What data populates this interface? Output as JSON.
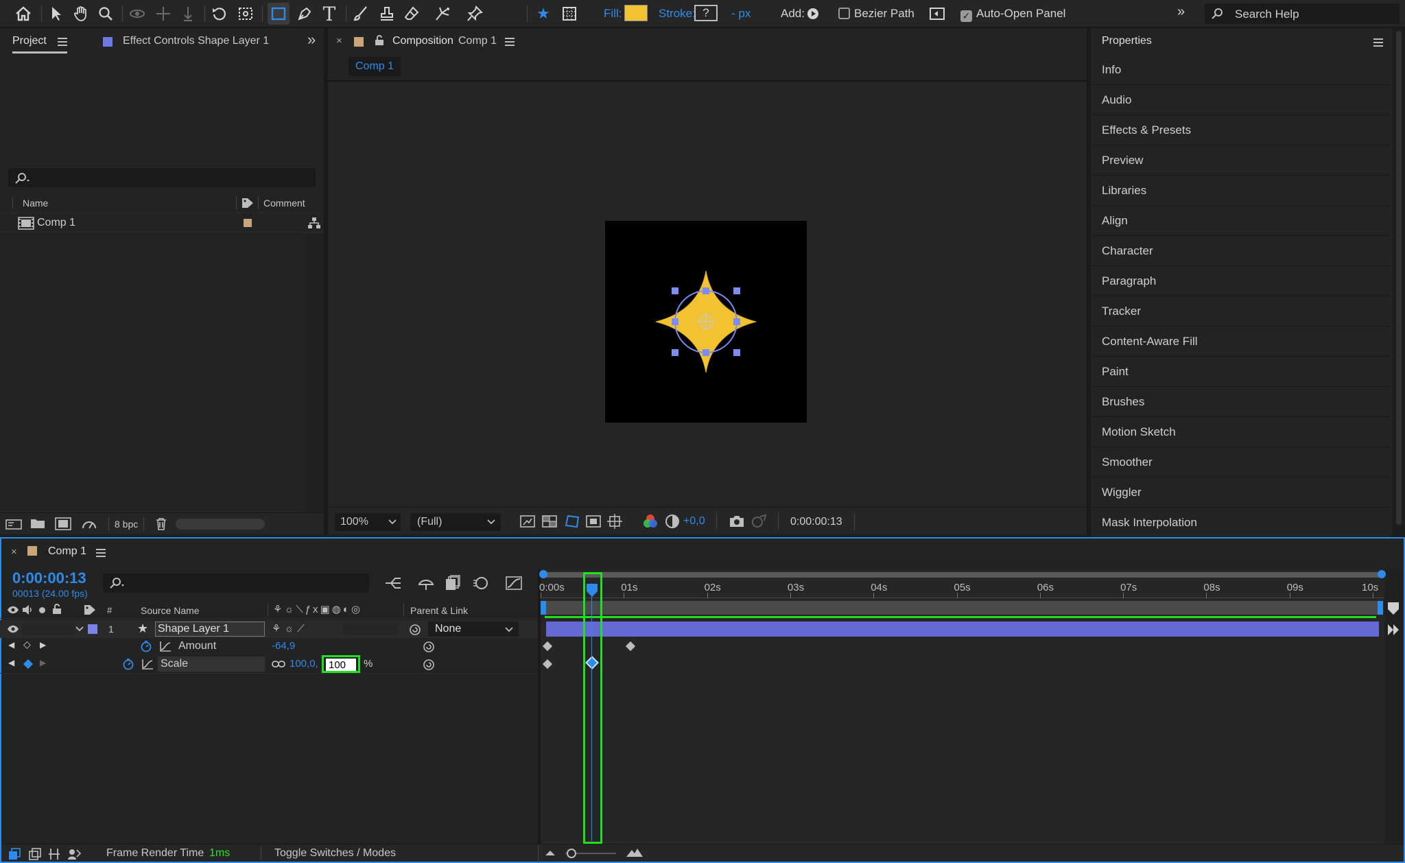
{
  "toolbar": {
    "fill_label": "Fill:",
    "fill_color": "#f2c230",
    "stroke_label": "Stroke:",
    "stroke_value": "?",
    "stroke_unit": "- px",
    "add_label": "Add:",
    "bezier_label": "Bezier Path",
    "auto_open_label": "Auto-Open Panel",
    "search_placeholder": "Search Help"
  },
  "project_panel": {
    "tab_project": "Project",
    "tab_effect_controls": "Effect Controls Shape Layer 1",
    "col_name": "Name",
    "col_comment": "Comment",
    "items": [
      {
        "name": "Comp 1",
        "label_color": "#c8a67a"
      }
    ],
    "bpc": "8 bpc"
  },
  "composition_panel": {
    "tab_prefix": "Composition",
    "tab_name": "Comp 1",
    "subtab": "Comp 1",
    "zoom": "100%",
    "resolution": "(Full)",
    "exposure": "+0,0",
    "timecode": "0:00:00:13"
  },
  "properties_panel": {
    "title": "Properties",
    "items": [
      "Info",
      "Audio",
      "Effects & Presets",
      "Preview",
      "Libraries",
      "Align",
      "Character",
      "Paragraph",
      "Tracker",
      "Content-Aware Fill",
      "Paint",
      "Brushes",
      "Motion Sketch",
      "Smoother",
      "Wiggler",
      "Mask Interpolation"
    ]
  },
  "timeline": {
    "tab_name": "Comp 1",
    "timecode": "0:00:00:13",
    "frame_info": "00013 (24.00 fps)",
    "col_number": "#",
    "col_source_name": "Source Name",
    "col_parent": "Parent & Link",
    "layer": {
      "number": "1",
      "name": "Shape Layer 1",
      "label_color": "#7b84e6",
      "parent": "None"
    },
    "properties": [
      {
        "name": "Amount",
        "value": "-64,9"
      },
      {
        "name": "Scale",
        "value_x": "100,0,",
        "value_y_editing": "100",
        "unit": "%"
      }
    ],
    "ruler": [
      "0:00s",
      "01s",
      "02s",
      "03s",
      "04s",
      "05s",
      "06s",
      "07s",
      "08s",
      "09s",
      "10s"
    ],
    "footer_render_label": "Frame Render Time",
    "footer_render_value": "1ms",
    "footer_toggle": "Toggle Switches / Modes"
  },
  "colors": {
    "accent_blue": "#2d8ceb",
    "highlight_green": "#22e01f",
    "layer_bar": "#6569d6",
    "star_fill": "#f2c230",
    "handle": "#7c8cf2"
  }
}
